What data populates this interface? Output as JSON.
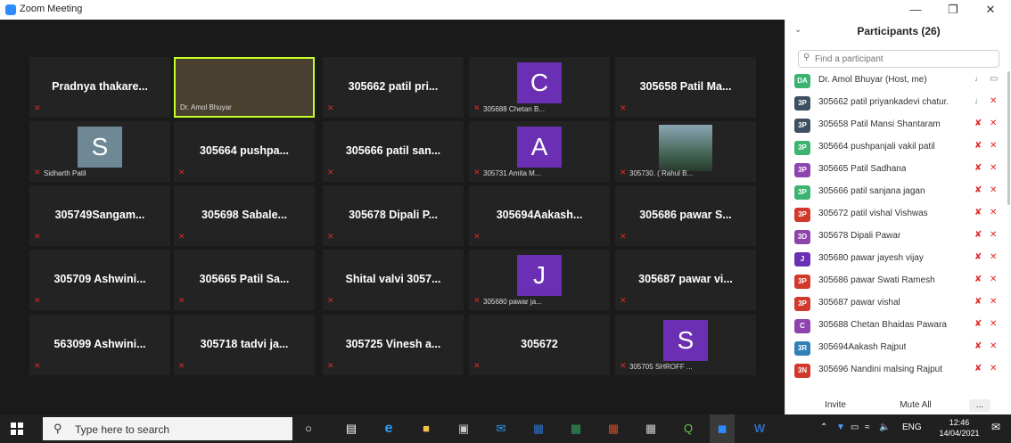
{
  "window": {
    "title": "Zoom Meeting",
    "minimize": "—",
    "restore": "❐",
    "close": "✕"
  },
  "gallery": [
    {
      "big": "Pradnya  thakare...",
      "small": ""
    },
    {
      "video": true,
      "small": "Dr. Amol Bhuyar"
    },
    {
      "big": "305662 patil pri...",
      "small": ""
    },
    {
      "avatar": "C",
      "avatar_color": "#6b2fb3",
      "small": "305688 Chetan B..."
    },
    {
      "big": "305658 Patil Ma...",
      "small": ""
    },
    {
      "avatar": "S",
      "avatar_color": "#6e8896",
      "small": "Sidharth Patil"
    },
    {
      "big": "305664 pushpa...",
      "small": ""
    },
    {
      "big": "305666 patil san...",
      "small": ""
    },
    {
      "avatar": "A",
      "avatar_color": "#6b2fb3",
      "small": "305731 Amita M..."
    },
    {
      "photo": true,
      "small": "305730. ( Rahul B..."
    },
    {
      "big": "305749Sangam...",
      "small": ""
    },
    {
      "big": "305698 Sabale...",
      "small": ""
    },
    {
      "big": "305678 Dipali P...",
      "small": ""
    },
    {
      "big": "305694Aakash...",
      "small": ""
    },
    {
      "big": "305686 pawar S...",
      "small": ""
    },
    {
      "big": "305709 Ashwini...",
      "small": ""
    },
    {
      "big": "305665 Patil Sa...",
      "small": ""
    },
    {
      "big": "Shital valvi 3057...",
      "small": ""
    },
    {
      "avatar": "J",
      "avatar_color": "#6b2fb3",
      "small": "305680 pawar ja..."
    },
    {
      "big": "305687 pawar vi...",
      "small": ""
    },
    {
      "big": "563099 Ashwini...",
      "small": ""
    },
    {
      "big": "305718 tadvi ja...",
      "small": ""
    },
    {
      "big": "305725 Vinesh a...",
      "small": ""
    },
    {
      "big": "305672",
      "small": ""
    },
    {
      "avatar": "S",
      "avatar_color": "#6b2fb3",
      "small": "305705 SHROFF ..."
    }
  ],
  "participants": {
    "title": "Participants (26)",
    "search_placeholder": "Find a participant",
    "list": [
      {
        "initials": "DA",
        "color": "#3cb371",
        "name": "Dr. Amol Bhuyar (Host, me)",
        "muted": false,
        "video_off": false
      },
      {
        "initials": "3P",
        "color": "#3d4f61",
        "name": "305662 patil priyankadevi chatur.",
        "muted": false,
        "video_off": true
      },
      {
        "initials": "3P",
        "color": "#3d4f61",
        "name": "305658 Patil Mansi Shantaram",
        "muted": true,
        "video_off": true
      },
      {
        "initials": "3P",
        "color": "#3cb371",
        "name": "305664 pushpanjali vakil patil",
        "muted": true,
        "video_off": true
      },
      {
        "initials": "3P",
        "color": "#8e44ad",
        "name": "305665 Patil Sadhana",
        "muted": true,
        "video_off": true
      },
      {
        "initials": "3P",
        "color": "#3cb371",
        "name": "305666 patil sanjana jagan",
        "muted": true,
        "video_off": true
      },
      {
        "initials": "3P",
        "color": "#d0392b",
        "name": "305672  patil  vishal Vishwas",
        "muted": true,
        "video_off": true
      },
      {
        "initials": "3D",
        "color": "#8e44ad",
        "name": "305678 Dipali Pawar",
        "muted": true,
        "video_off": true
      },
      {
        "initials": "J",
        "color": "#6b2fb3",
        "name": "305680 pawar jayesh vijay",
        "muted": true,
        "video_off": true
      },
      {
        "initials": "3P",
        "color": "#d0392b",
        "name": "305686 pawar Swati Ramesh",
        "muted": true,
        "video_off": true
      },
      {
        "initials": "3P",
        "color": "#d0392b",
        "name": "305687 pawar vishal",
        "muted": true,
        "video_off": true
      },
      {
        "initials": "C",
        "color": "#8e44ad",
        "name": "305688 Chetan Bhaidas Pawara",
        "muted": true,
        "video_off": true
      },
      {
        "initials": "3R",
        "color": "#2f80b7",
        "name": "305694Aakash Rajput",
        "muted": true,
        "video_off": true
      },
      {
        "initials": "3N",
        "color": "#d0392b",
        "name": "305696 Nandini malsing Rajput",
        "muted": true,
        "video_off": true
      }
    ],
    "invite": "Invite",
    "mute_all": "Mute All",
    "more": "..."
  },
  "taskbar": {
    "search_placeholder": "Type here to search",
    "tray_lang": "ENG",
    "time": "12:46",
    "date": "14/04/2021",
    "notifications": "1"
  }
}
